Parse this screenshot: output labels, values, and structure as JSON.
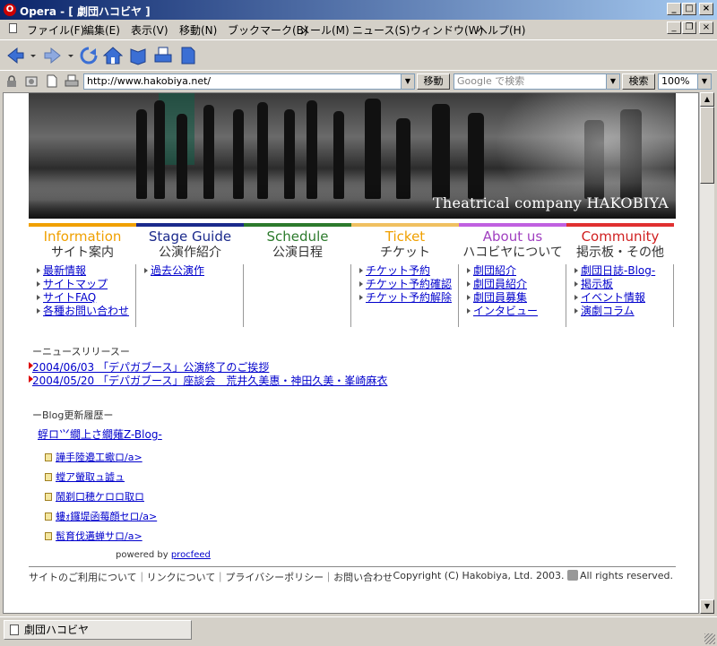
{
  "window": {
    "title": "Opera - [ 劇団ハコビヤ ]",
    "app_icon": "opera-icon",
    "controls": [
      "minimize-icon",
      "maximize-icon",
      "close-icon"
    ]
  },
  "menu": [
    "ファイル(F)",
    "編集(E)",
    "表示(V)",
    "移動(N)",
    "ブックマーク(B)",
    "メール(M)",
    "ニュース(S)",
    "ウィンドウ(W)",
    "ヘルプ(H)"
  ],
  "toolbar": {
    "icons": [
      "back-icon",
      "forward-icon",
      "reload-icon",
      "home-icon",
      "bookmark-icon",
      "print-icon",
      "page-icon"
    ]
  },
  "address": {
    "url": "http://www.hakobiya.net/",
    "go_label": "移動",
    "search_placeholder": "Google で検索",
    "search_label": "検索",
    "zoom": "100%"
  },
  "page": {
    "banner_tagline": "Theatrical company HAKOBIYA",
    "nav": [
      {
        "en": "Information",
        "ja": "サイト案内",
        "color": "#f0a000",
        "bar": "#f0a000",
        "links": [
          "最新情報",
          "サイトマップ",
          "サイトFAQ",
          "各種お問い合わせ"
        ]
      },
      {
        "en": "Stage Guide",
        "ja": "公演作紹介",
        "color": "#1b2a8c",
        "bar": "#1b2a8c",
        "links": [
          "過去公演作"
        ]
      },
      {
        "en": "Schedule",
        "ja": "公演日程",
        "color": "#2c7a2c",
        "bar": "#2c7a2c",
        "links": []
      },
      {
        "en": "Ticket",
        "ja": "チケット",
        "color": "#f0a000",
        "bar": "#f0c060",
        "links": [
          "チケット予約",
          "チケット予約確認",
          "チケット予約解除"
        ]
      },
      {
        "en": "About us",
        "ja": "ハコビヤについて",
        "color": "#a040c0",
        "bar": "#c060e0",
        "links": [
          "劇団紹介",
          "劇団員紹介",
          "劇団員募集",
          "インタビュー"
        ]
      },
      {
        "en": "Community",
        "ja": "掲示板・その他",
        "color": "#d02020",
        "bar": "#e03030",
        "links": [
          "劇団日誌-Blog-",
          "掲示板",
          "イベント情報",
          "演劇コラム"
        ]
      }
    ],
    "news_heading": "ーニュースリリースー",
    "news": [
      "2004/06/03 「デパガブース」公演終了のご挨拶",
      "2004/05/20 「デパガブース」座談会　荒井久美惠・神田久美・峯崎麻衣"
    ],
    "blog_heading": "ーBlog更新履歴ー",
    "blog_title": "蜉ロ⺍繝上さ繝薙Z-Blog-",
    "blog_items": [
      "譁手陸邉⼯蠍ロ/a>",
      "螳ア螢取ュ譃ュ",
      "鬧剃⼝穂ケロロ取ロ",
      "螻ｫ鑼堤函莓顔セロ/a>",
      "髢育伐遘蝉サロ/a>"
    ],
    "powered_by": "powered by",
    "powered_link": "procfeed",
    "footer_links": "サイトのご利用について｜リンクについて｜プライバシーポリシー｜お問い合わせ",
    "copyright": "Copyright (C) Hakobiya, Ltd. 2003.",
    "rights": "All rights reserved."
  },
  "status": {
    "tab_label": "劇団ハコビヤ"
  }
}
